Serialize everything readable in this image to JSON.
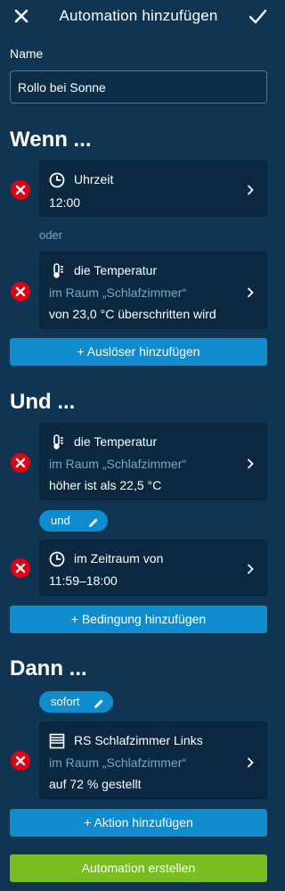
{
  "header": {
    "title": "Automation hinzufügen"
  },
  "name": {
    "label": "Name",
    "value": "Rollo bei Sonne"
  },
  "wenn": {
    "title": "Wenn ...",
    "card1": {
      "icon": "clock-icon",
      "title": "Uhrzeit",
      "detail": "12:00"
    },
    "separator": "oder",
    "card2": {
      "icon": "thermometer-icon",
      "title": "die Temperatur",
      "room": "im Raum „Schlafzimmer“",
      "detail": "von 23,0 °C überschritten wird"
    },
    "add_button": "+ Auslöser hinzufügen"
  },
  "und": {
    "title": "Und ...",
    "card1": {
      "icon": "thermometer-icon",
      "title": "die Temperatur",
      "room": "im Raum „Schlafzimmer“",
      "detail": "höher ist als 22,5 °C"
    },
    "chip": "und",
    "card2": {
      "icon": "clock-icon",
      "title": "im Zeitraum von",
      "detail": "11:59–18:00"
    },
    "add_button": "+ Bedingung hinzufügen"
  },
  "dann": {
    "title": "Dann ...",
    "chip": "sofort",
    "card1": {
      "icon": "shutter-icon",
      "title": "RS Schlafzimmer Links",
      "room": "im Raum „Schlafzimmer“",
      "detail": "auf 72 % gestellt"
    },
    "add_button": "+ Aktion hinzufügen"
  },
  "create_button": "Automation erstellen",
  "colors": {
    "background": "#0f3552",
    "card": "#0b2840",
    "accent_blue": "#0e8cce",
    "accent_green": "#78be20",
    "delete_red": "#e20015",
    "secondary_text": "#7aa7c7"
  }
}
